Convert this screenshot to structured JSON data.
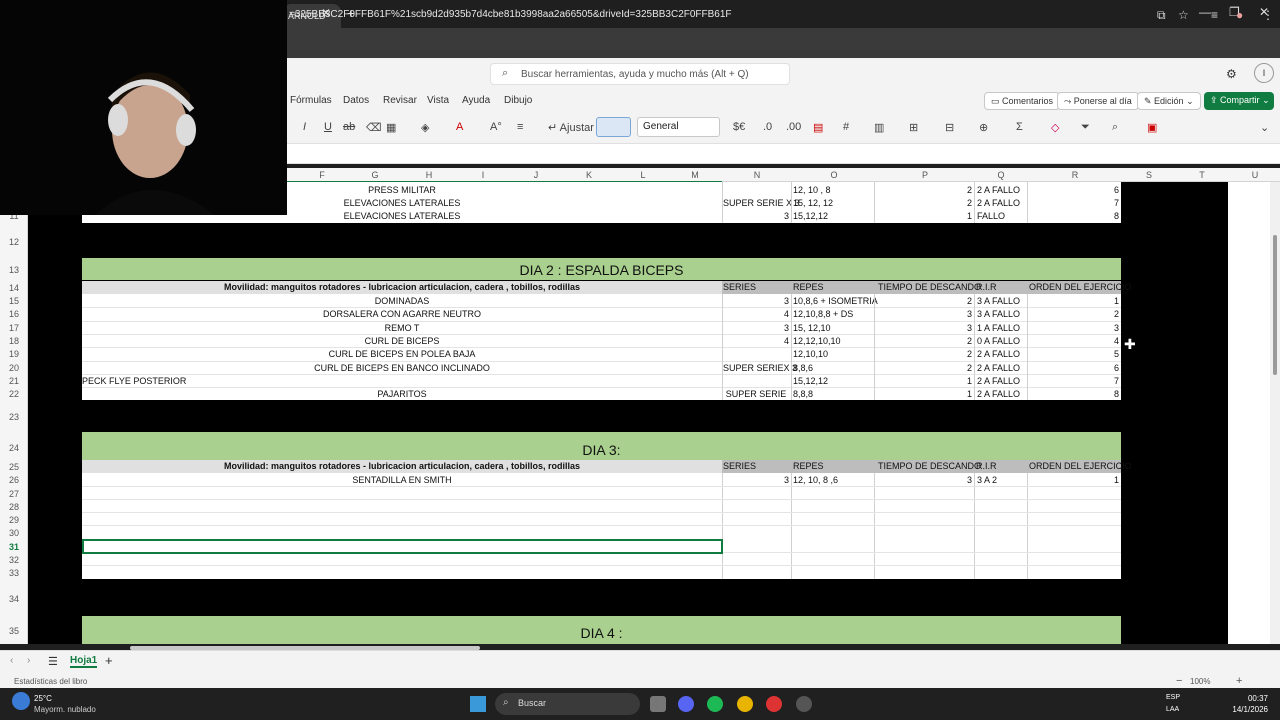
{
  "browser": {
    "tab_title": "ARNOLD",
    "url": "=325BB3C2F0FFB61F%21scb9d2d935b7d4cbe81b3998aa2a66505&driveId=325BB3C2F0FFB61F",
    "new_tab_label": "+",
    "tab_close_label": "✕"
  },
  "excel": {
    "search_placeholder": "Buscar herramientas, ayuda y mucho más (Alt + Q)",
    "menu": [
      "Fórmulas",
      "Datos",
      "Revisar",
      "Vista",
      "Ayuda",
      "Dibujo"
    ],
    "comments_label": "Comentarios",
    "catchup_label": "Ponerse al día",
    "edit_label": "Edición",
    "share_label": "Compartir",
    "wrap_label": "Ajustar",
    "number_format": "General",
    "columns": [
      "F",
      "G",
      "H",
      "I",
      "J",
      "K",
      "L",
      "M",
      "N",
      "O",
      "P",
      "Q",
      "R",
      "S",
      "T",
      "U"
    ],
    "sheet_tab": "Hoja1",
    "status_left": "Estadísticas del libro",
    "zoom": "100%"
  },
  "rows": {
    "numbers": [
      "11",
      "12",
      "13",
      "14",
      "15",
      "16",
      "17",
      "18",
      "19",
      "20",
      "21",
      "22",
      "23",
      "24",
      "25",
      "26",
      "27",
      "28",
      "29",
      "30",
      "31",
      "32",
      "33",
      "34",
      "35"
    ]
  },
  "block_top": [
    {
      "name": "PRESS MILITAR",
      "series": "",
      "repes": "12, 10 , 8",
      "descanso": "2",
      "rir": "2 A FALLO",
      "orden": "6"
    },
    {
      "name": "ELEVACIONES LATERALES",
      "series": "SUPER SERIE X 3",
      "repes": "15, 12, 12",
      "descanso": "2",
      "rir": "2 A FALLO",
      "orden": "7"
    },
    {
      "name": "ELEVACIONES LATERALES",
      "series": "3",
      "repes": "15,12,12",
      "descanso": "1",
      "rir": "FALLO",
      "orden": "8"
    }
  ],
  "day2": {
    "title": "DIA 2 : ESPALDA BICEPS",
    "mobility": "Movilidad: manguitos rotadores - lubricacion articulacion, cadera , tobillos, rodillas",
    "headers": {
      "series": "SERIES",
      "repes": "REPES",
      "descanso": "TIEMPO DE DESCANDO",
      "rir": "R.I.R",
      "orden": "ORDEN DEL EJERCICIO"
    },
    "rows": [
      {
        "name": "DOMINADAS",
        "series": "3",
        "repes": "10,8,6 + ISOMETRIA",
        "descanso": "2",
        "rir": "3 A FALLO",
        "orden": "1"
      },
      {
        "name": "DORSALERA CON AGARRE NEUTRO",
        "series": "4",
        "repes": "12,10,8,8 + DS",
        "descanso": "3",
        "rir": "3 A FALLO",
        "orden": "2"
      },
      {
        "name": "REMO T",
        "series": "3",
        "repes": "15, 12,10",
        "descanso": "3",
        "rir": "1 A FALLO",
        "orden": "3"
      },
      {
        "name": "CURL DE BICEPS",
        "series": "4",
        "repes": "12,12,10,10",
        "descanso": "2",
        "rir": "0 A FALLO",
        "orden": "4"
      },
      {
        "name": "CURL DE BICEPS EN POLEA BAJA",
        "series": "",
        "repes": "12,10,10",
        "descanso": "2",
        "rir": "2 A FALLO",
        "orden": "5"
      },
      {
        "name": "CURL DE BICEPS EN BANCO INCLINADO",
        "series": "SUPER SERIEX 3",
        "repes": "8,8,6",
        "descanso": "2",
        "rir": "2 A FALLO",
        "orden": "6"
      },
      {
        "name": "PECK FLYE POSTERIOR",
        "series": "",
        "repes": "15,12,12",
        "descanso": "1",
        "rir": "2 A FALLO",
        "orden": "7"
      },
      {
        "name": "PAJARITOS",
        "series": "SUPER SERIE",
        "repes": "8,8,8",
        "descanso": "1",
        "rir": "2 A FALLO",
        "orden": "8"
      }
    ]
  },
  "day3": {
    "title": "DIA 3:",
    "mobility": "Movilidad: manguitos rotadores - lubricacion articulacion, cadera , tobillos, rodillas",
    "headers": {
      "series": "SERIES",
      "repes": "REPES",
      "descanso": "TIEMPO DE DESCANDO",
      "rir": "R.I.R",
      "orden": "ORDEN DEL EJERCICIO"
    },
    "rows": [
      {
        "name": "SENTADILLA EN SMITH",
        "series": "3",
        "repes": "12, 10, 8 ,6",
        "descanso": "3",
        "rir": "3 A 2",
        "orden": "1"
      }
    ]
  },
  "day4": {
    "title": "DIA 4 :"
  },
  "taskbar": {
    "weather_temp": "25°C",
    "weather_desc": "Mayorm. nublado",
    "search_label": "Buscar",
    "lang": "ESP",
    "lang2": "LAA",
    "time": "00:37",
    "date": "14/1/2026"
  }
}
